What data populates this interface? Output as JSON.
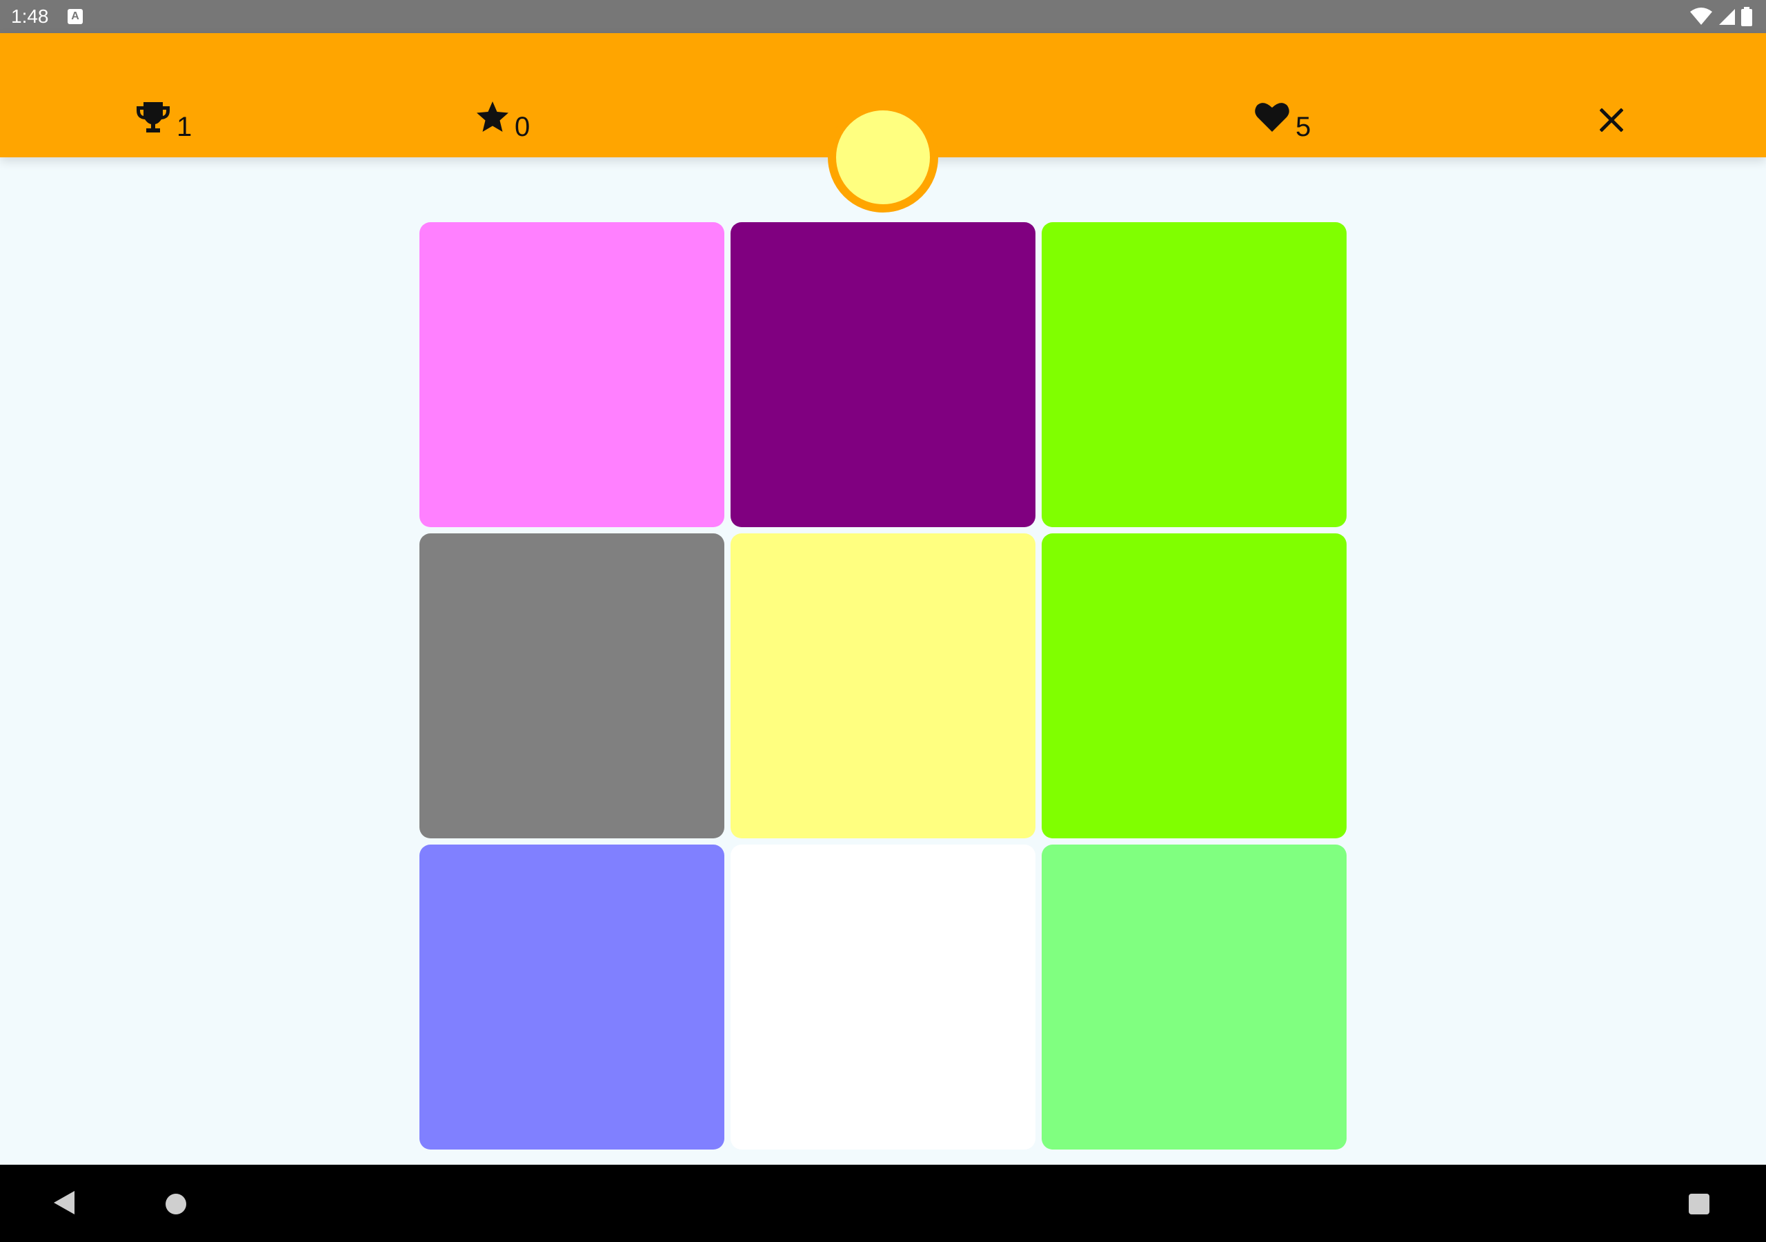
{
  "status_bar": {
    "time": "1:48",
    "notification_icon_letter": "A",
    "icons": [
      "wifi-icon",
      "signal-icon",
      "battery-icon"
    ]
  },
  "stats": {
    "trophies": "1",
    "stars": "0",
    "lives": "5"
  },
  "colors": {
    "app_bar": "#ffa500",
    "background": "#f2fafd",
    "target_color": "#ffff80"
  },
  "tiles": [
    {
      "color": "#ff80ff"
    },
    {
      "color": "#800080"
    },
    {
      "color": "#80ff00"
    },
    {
      "color": "#808080"
    },
    {
      "color": "#ffff80"
    },
    {
      "color": "#80ff00"
    },
    {
      "color": "#8080ff"
    },
    {
      "color": "#ffffff"
    },
    {
      "color": "#80ff80"
    }
  ],
  "nav_bar": {
    "icons": [
      "back-icon",
      "home-icon",
      "recents-icon"
    ]
  }
}
